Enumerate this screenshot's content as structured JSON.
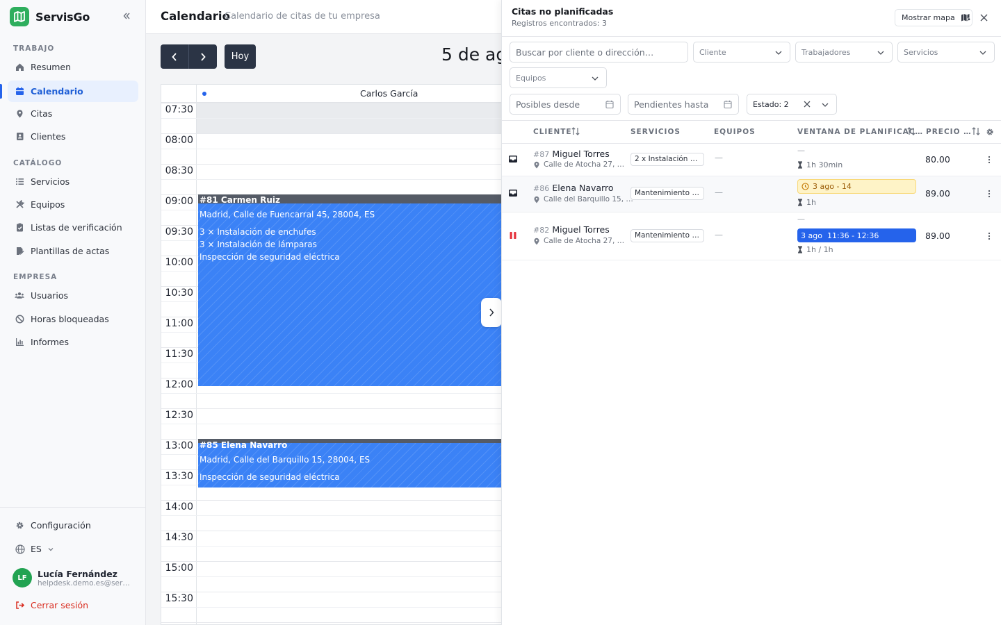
{
  "brand": {
    "name": "ServisGo"
  },
  "sidebar": {
    "sections": {
      "trabajo": "TRABAJO",
      "catalogo": "CATÁLOGO",
      "empresa": "EMPRESA"
    },
    "items": [
      {
        "label": "Resumen",
        "icon": "home-icon"
      },
      {
        "label": "Calendario",
        "icon": "calendar-icon",
        "active": true
      },
      {
        "label": "Citas",
        "icon": "map-pin-icon"
      },
      {
        "label": "Clientes",
        "icon": "contact-book-icon"
      },
      {
        "label": "Servicios",
        "icon": "list-icon"
      },
      {
        "label": "Equipos",
        "icon": "tools-icon"
      },
      {
        "label": "Listas de verificación",
        "icon": "clipboard-check-icon"
      },
      {
        "label": "Plantillas de actas",
        "icon": "document-edit-icon"
      },
      {
        "label": "Usuarios",
        "icon": "users-icon"
      },
      {
        "label": "Horas bloqueadas",
        "icon": "ban-icon"
      },
      {
        "label": "Informes",
        "icon": "bar-chart-icon"
      }
    ],
    "settings_label": "Configuración",
    "language": "ES",
    "user": {
      "initials": "LF",
      "name": "Lucía Fernández",
      "email": "helpdesk.demo.es@servis…"
    },
    "logout_label": "Cerrar sesión"
  },
  "header": {
    "title": "Calendario",
    "subtitle": "Calendario de citas de tu empresa"
  },
  "calendar": {
    "today_label": "Hoy",
    "date_title": "5 de ag",
    "worker": "Carlos García",
    "times": [
      "07:30",
      "08:00",
      "08:30",
      "09:00",
      "09:30",
      "10:00",
      "10:30",
      "11:00",
      "11:30",
      "12:00",
      "12:30",
      "13:00",
      "13:30",
      "14:00",
      "14:30",
      "15:00",
      "15:30"
    ],
    "events": [
      {
        "title": "#81 Carmen Ruiz",
        "address": "Madrid, Calle de Fuencarral 45, 28004, ES",
        "lines": [
          "3 × Instalación de enchufes",
          "3 × Instalación de lámparas",
          "Inspección de seguridad eléctrica"
        ]
      },
      {
        "title": "#85 Elena Navarro",
        "address": "Madrid, Calle del Barquillo 15, 28004, ES",
        "lines": [
          "Inspección de seguridad eléctrica"
        ]
      }
    ]
  },
  "panel": {
    "title": "Citas no planificadas",
    "count": "Registros encontrados: 3",
    "map_button": "Mostrar mapa",
    "filters": {
      "search_placeholder": "Buscar por cliente o dirección…",
      "cliente": "Cliente",
      "trabajadores": "Trabajadores",
      "servicios": "Servicios",
      "equipos": "Equipos",
      "posibles_desde": "Posibles desde",
      "pendientes_hasta": "Pendientes hasta",
      "estado": "Estado: 2"
    },
    "columns": {
      "cliente": "CLIENTE",
      "servicios": "SERVICIOS",
      "equipos": "EQUIPOS",
      "ventana": "VENTANA DE PLANIFICAC…",
      "precio": "PRECIO …"
    },
    "rows": [
      {
        "id": "#87",
        "name": "Miguel Torres",
        "address": "Calle de Atocha 27, …",
        "service": "2 x Instalación de…",
        "equipment": "—",
        "window_top": "—",
        "duration": "1h 30min",
        "price": "80.00",
        "status_icon": "inbox-icon"
      },
      {
        "id": "#86",
        "name": "Elena Navarro",
        "address": "Calle del Barquillo 15, …",
        "service": "Mantenimiento d…",
        "equipment": "—",
        "window": "3 ago - 14",
        "duration": "1h",
        "price": "89.00",
        "status_icon": "inbox-icon"
      },
      {
        "id": "#82",
        "name": "Miguel Torres",
        "address": "Calle de Atocha 27, …",
        "service": "Mantenimiento d…",
        "equipment": "—",
        "window_top": "—",
        "window_date": "3 ago",
        "window_time": "11:36 - 12:36",
        "duration": "1h / 1h",
        "price": "89.00",
        "status_icon": "pause-icon"
      }
    ]
  },
  "colors": {
    "brand": "#2eae5d",
    "accent": "#2563eb",
    "event": "#3b82f6",
    "danger": "#d92d20"
  }
}
